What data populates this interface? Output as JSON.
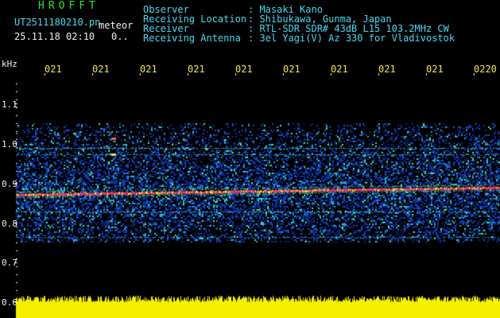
{
  "header": {
    "app_title": "HROFFT",
    "file_name": "UT2511180210.pn",
    "file_tag": "meteor",
    "timestamp": "25.11.18 02:10",
    "count": "0..",
    "fields": [
      {
        "label": "Observer",
        "value": ": Masaki Kano"
      },
      {
        "label": "Receiving Location",
        "value": ": Shibukawa, Gunma, Japan"
      },
      {
        "label": "Receiver",
        "value": ": RTL-SDR SDR# 43dB L15 103.2MHz CW"
      },
      {
        "label": "Receiving Antenna",
        "value": ": 3el Yagi(V) Az 330 for Vladivostok"
      }
    ]
  },
  "time_axis": {
    "ticks": [
      "021",
      "021",
      "021",
      "021",
      "021",
      "021",
      "021",
      "021",
      "021",
      "0220"
    ]
  },
  "freq_axis": {
    "unit": "kHz",
    "ticks": [
      "1.1",
      "1.0",
      "0.9",
      "0.8",
      "0.7",
      "0.6"
    ]
  },
  "colors": {
    "background": "#000000",
    "signal_band": "#ff3a5a",
    "noise_high": "#20d0a0",
    "noise_low": "#1030c0",
    "level_bar": "#f5f000",
    "tick_text": "#f5e640",
    "label_cyan": "#49d9f5",
    "title_green": "#33e033"
  }
}
